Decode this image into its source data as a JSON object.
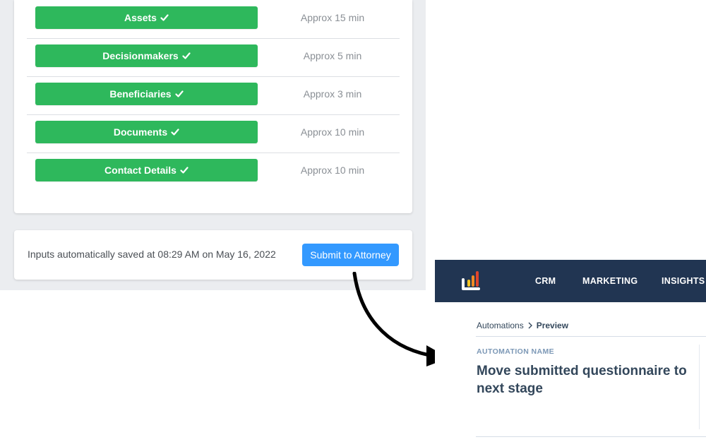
{
  "questionnaire": {
    "sections": [
      {
        "label": "Assets",
        "approx": "Approx 15 min"
      },
      {
        "label": "Decisionmakers",
        "approx": "Approx 5 min"
      },
      {
        "label": "Beneficiaries",
        "approx": "Approx 3 min"
      },
      {
        "label": "Documents",
        "approx": "Approx 10 min"
      },
      {
        "label": "Contact Details",
        "approx": "Approx 10 min"
      }
    ],
    "status_icon": "check-icon",
    "save_status": "Inputs automatically saved at 08:29 AM on May 16, 2022",
    "submit_label": "Submit to Attorney"
  },
  "crm": {
    "nav": [
      "CRM",
      "MARKETING",
      "INSIGHTS"
    ],
    "breadcrumb": {
      "parent": "Automations",
      "current": "Preview"
    },
    "automation_label": "AUTOMATION NAME",
    "automation_name": "Move submitted questionnaire to next stage"
  },
  "colors": {
    "section_green": "#2eb85c",
    "submit_blue": "#3399ff",
    "nav_navy": "#213552"
  }
}
